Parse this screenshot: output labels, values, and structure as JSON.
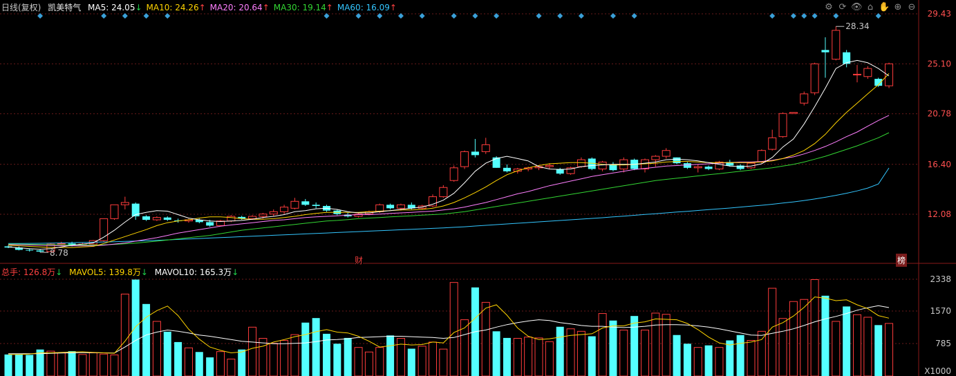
{
  "header": {
    "period": "日线(复权)",
    "stock_name": "凯美特气",
    "ma": [
      {
        "label": "MA5: 24.05",
        "arrow": "↓",
        "color": "#ffffff",
        "arrow_color": "#1fd04a"
      },
      {
        "label": "MA10: 24.26",
        "arrow": "↑",
        "color": "#ffd400",
        "arrow_color": "#ff4040"
      },
      {
        "label": "MA20: 20.64",
        "arrow": "↑",
        "color": "#ff7fff",
        "arrow_color": "#ff4040"
      },
      {
        "label": "MA30: 19.14",
        "arrow": "↑",
        "color": "#33d633",
        "arrow_color": "#ff4040"
      },
      {
        "label": "MA60: 16.09",
        "arrow": "↑",
        "color": "#33c6ff",
        "arrow_color": "#ff4040"
      }
    ]
  },
  "vol_header": {
    "total": {
      "label": "总手: 126.8万",
      "arrow": "↓",
      "color": "#ff4040",
      "arrow_color": "#1fd04a"
    },
    "mavol5": {
      "label": "MAVOL5: 139.8万",
      "arrow": "↓",
      "color": "#ffd400",
      "arrow_color": "#1fd04a"
    },
    "mavol10": {
      "label": "MAVOL10: 165.3万",
      "arrow": "↓",
      "color": "#ffffff",
      "arrow_color": "#1fd04a"
    }
  },
  "toolbar": {
    "icons": [
      "gear-icon",
      "refresh-icon",
      "eye-icon",
      "shop-icon",
      "hand-icon",
      "zoom-in-icon",
      "zoom-out-icon"
    ],
    "glyphs": [
      "⚙",
      "⟳",
      "👁",
      "⌂",
      "✋",
      "⊕",
      "⊖"
    ]
  },
  "markers": {
    "cai": "财",
    "bang": "榜"
  },
  "annotations": {
    "high": "28.34",
    "low": "8.78"
  },
  "colors": {
    "up": "#ff3c3c",
    "down": "#54ffff",
    "grid": "#6a1a1a",
    "ma5": "#ffffff",
    "ma10": "#ffd400",
    "ma20": "#ff7fff",
    "ma30": "#33d633",
    "ma60": "#33c6ff",
    "diamond": "#3aa0d8"
  },
  "chart_data": [
    {
      "type": "candlestick",
      "title": "",
      "y_ticks": [
        "29.43",
        "25.10",
        "20.78",
        "16.40",
        "12.08"
      ],
      "ylim": [
        8.0,
        30.5
      ],
      "candles": [
        [
          9.3,
          9.4,
          9.15,
          9.2
        ],
        [
          9.2,
          9.3,
          8.95,
          9.0
        ],
        [
          9.0,
          9.1,
          8.85,
          8.95
        ],
        [
          8.95,
          9.05,
          8.78,
          8.85
        ],
        [
          8.85,
          9.6,
          8.8,
          9.5
        ],
        [
          9.5,
          9.7,
          9.4,
          9.55
        ],
        [
          9.55,
          9.7,
          9.3,
          9.4
        ],
        [
          9.4,
          9.6,
          9.35,
          9.5
        ],
        [
          9.5,
          9.85,
          9.45,
          9.8
        ],
        [
          9.8,
          11.7,
          9.7,
          11.7
        ],
        [
          11.7,
          12.9,
          11.6,
          12.9
        ],
        [
          12.9,
          13.6,
          12.5,
          13.1
        ],
        [
          13.0,
          13.1,
          11.6,
          11.9
        ],
        [
          11.9,
          12.0,
          11.5,
          11.6
        ],
        [
          11.6,
          11.9,
          11.5,
          11.8
        ],
        [
          11.8,
          11.9,
          11.5,
          11.6
        ],
        [
          11.55,
          11.7,
          11.35,
          11.5
        ],
        [
          11.5,
          11.7,
          11.35,
          11.6
        ],
        [
          11.6,
          11.7,
          11.3,
          11.4
        ],
        [
          11.4,
          11.6,
          11.0,
          11.1
        ],
        [
          11.1,
          11.6,
          11.05,
          11.5
        ],
        [
          11.5,
          12.0,
          11.4,
          11.9
        ],
        [
          11.85,
          11.95,
          11.6,
          11.7
        ],
        [
          11.7,
          12.0,
          11.6,
          11.9
        ],
        [
          11.9,
          12.2,
          11.7,
          12.1
        ],
        [
          12.1,
          12.5,
          11.9,
          12.3
        ],
        [
          12.3,
          12.9,
          12.1,
          12.7
        ],
        [
          12.6,
          13.5,
          12.5,
          13.2
        ],
        [
          13.2,
          13.4,
          12.8,
          12.9
        ],
        [
          12.9,
          13.1,
          12.6,
          12.8
        ],
        [
          12.8,
          12.9,
          12.3,
          12.4
        ],
        [
          12.4,
          12.5,
          12.0,
          12.1
        ],
        [
          12.05,
          12.2,
          11.8,
          11.9
        ],
        [
          11.9,
          12.2,
          11.8,
          12.1
        ],
        [
          12.1,
          12.4,
          12.0,
          12.3
        ],
        [
          12.3,
          13.0,
          12.2,
          12.9
        ],
        [
          12.9,
          13.0,
          12.5,
          12.6
        ],
        [
          12.6,
          13.0,
          12.4,
          12.9
        ],
        [
          12.9,
          13.1,
          12.5,
          12.6
        ],
        [
          12.6,
          12.9,
          12.5,
          12.8
        ],
        [
          12.8,
          13.8,
          12.7,
          13.6
        ],
        [
          13.6,
          14.6,
          13.5,
          14.4
        ],
        [
          15.0,
          16.3,
          14.9,
          16.1
        ],
        [
          16.2,
          17.6,
          16.0,
          17.5
        ],
        [
          17.5,
          18.6,
          17.0,
          17.2
        ],
        [
          17.5,
          18.7,
          17.3,
          18.1
        ],
        [
          17.0,
          17.1,
          16.1,
          16.1
        ],
        [
          16.1,
          16.4,
          15.7,
          15.8
        ],
        [
          15.8,
          16.1,
          15.6,
          16.0
        ],
        [
          16.0,
          16.2,
          15.8,
          16.1
        ],
        [
          16.1,
          16.3,
          15.9,
          16.2
        ],
        [
          16.2,
          16.5,
          16.0,
          16.3
        ],
        [
          16.0,
          16.1,
          15.5,
          15.6
        ],
        [
          15.6,
          16.2,
          15.5,
          16.1
        ],
        [
          16.2,
          17.0,
          16.1,
          16.8
        ],
        [
          16.9,
          17.0,
          15.9,
          16.0
        ],
        [
          16.0,
          16.7,
          15.8,
          16.6
        ],
        [
          16.4,
          16.6,
          15.8,
          15.9
        ],
        [
          16.0,
          17.0,
          15.7,
          16.8
        ],
        [
          16.8,
          16.9,
          15.9,
          16.0
        ],
        [
          16.0,
          16.9,
          15.7,
          16.8
        ],
        [
          16.8,
          17.2,
          16.2,
          17.1
        ],
        [
          17.1,
          17.8,
          16.9,
          17.6
        ],
        [
          17.0,
          17.0,
          16.4,
          16.5
        ],
        [
          16.5,
          16.6,
          16.0,
          16.1
        ],
        [
          16.1,
          16.4,
          15.7,
          16.2
        ],
        [
          16.2,
          16.3,
          15.9,
          16.0
        ],
        [
          16.0,
          16.7,
          15.9,
          16.6
        ],
        [
          16.6,
          16.8,
          16.2,
          16.3
        ],
        [
          16.3,
          16.4,
          15.9,
          16.0
        ],
        [
          16.1,
          16.6,
          16.0,
          16.5
        ],
        [
          16.6,
          17.7,
          16.5,
          17.6
        ],
        [
          17.7,
          19.4,
          17.6,
          18.7
        ],
        [
          18.8,
          20.9,
          18.7,
          20.8
        ],
        [
          20.8,
          20.9,
          20.8,
          20.9
        ],
        [
          21.7,
          22.7,
          21.5,
          22.5
        ],
        [
          22.6,
          25.2,
          22.4,
          25.1
        ],
        [
          26.3,
          27.4,
          23.9,
          26.1
        ],
        [
          25.5,
          28.34,
          25.4,
          28.0
        ],
        [
          26.1,
          26.3,
          24.8,
          25.1
        ],
        [
          24.2,
          25.0,
          23.5,
          24.2
        ],
        [
          24.0,
          24.9,
          23.8,
          24.7
        ],
        [
          23.8,
          23.9,
          23.1,
          23.2
        ],
        [
          23.2,
          25.2,
          23.0,
          25.1
        ]
      ],
      "ma5": [
        9.25,
        9.18,
        9.1,
        9.05,
        9.1,
        9.25,
        9.4,
        9.5,
        9.6,
        10.1,
        10.7,
        11.4,
        12.05,
        12.25,
        12.4,
        12.35,
        12.05,
        11.75,
        11.6,
        11.5,
        11.45,
        11.5,
        11.55,
        11.65,
        11.8,
        11.9,
        12.05,
        12.3,
        12.4,
        12.55,
        12.6,
        12.5,
        12.3,
        12.2,
        12.2,
        12.3,
        12.4,
        12.5,
        12.6,
        12.7,
        12.95,
        13.3,
        13.9,
        14.8,
        15.8,
        16.5,
        16.9,
        17.1,
        16.9,
        16.7,
        16.2,
        16.0,
        15.95,
        16.0,
        16.2,
        16.3,
        16.35,
        16.4,
        16.4,
        16.4,
        16.5,
        16.6,
        16.8,
        16.85,
        16.8,
        16.7,
        16.55,
        16.4,
        16.25,
        16.2,
        16.25,
        16.45,
        17.0,
        17.9,
        18.6,
        19.9,
        21.4,
        23.0,
        24.7,
        25.2,
        25.4,
        25.2,
        24.7,
        24.05
      ],
      "ma10": [
        9.4,
        9.35,
        9.3,
        9.25,
        9.2,
        9.2,
        9.2,
        9.25,
        9.3,
        9.55,
        9.85,
        10.15,
        10.45,
        10.75,
        11.1,
        11.35,
        11.5,
        11.6,
        11.75,
        11.85,
        11.85,
        11.8,
        11.7,
        11.65,
        11.65,
        11.7,
        11.8,
        11.9,
        12.05,
        12.15,
        12.25,
        12.25,
        12.25,
        12.25,
        12.3,
        12.35,
        12.4,
        12.45,
        12.45,
        12.5,
        12.6,
        12.8,
        13.1,
        13.5,
        13.95,
        14.45,
        15.0,
        15.5,
        15.85,
        16.1,
        16.3,
        16.45,
        16.5,
        16.55,
        16.55,
        16.5,
        16.4,
        16.35,
        16.35,
        16.4,
        16.45,
        16.5,
        16.6,
        16.65,
        16.65,
        16.6,
        16.55,
        16.55,
        16.55,
        16.55,
        16.55,
        16.6,
        16.7,
        16.9,
        17.2,
        17.6,
        18.2,
        19.0,
        20.0,
        20.9,
        21.7,
        22.5,
        23.3,
        24.26
      ],
      "ma20": [
        9.45,
        9.45,
        9.42,
        9.4,
        9.38,
        9.36,
        9.35,
        9.35,
        9.35,
        9.4,
        9.5,
        9.6,
        9.75,
        9.9,
        10.05,
        10.25,
        10.45,
        10.6,
        10.75,
        10.9,
        11.05,
        11.15,
        11.25,
        11.35,
        11.45,
        11.55,
        11.6,
        11.7,
        11.8,
        11.85,
        11.9,
        11.95,
        12.0,
        12.05,
        12.05,
        12.1,
        12.15,
        12.2,
        12.25,
        12.3,
        12.35,
        12.45,
        12.55,
        12.7,
        12.9,
        13.1,
        13.35,
        13.6,
        13.85,
        14.05,
        14.3,
        14.55,
        14.75,
        14.95,
        15.15,
        15.35,
        15.5,
        15.65,
        15.8,
        15.95,
        16.05,
        16.15,
        16.25,
        16.3,
        16.35,
        16.4,
        16.45,
        16.5,
        16.55,
        16.6,
        16.6,
        16.65,
        16.75,
        16.9,
        17.05,
        17.3,
        17.6,
        17.95,
        18.35,
        18.8,
        19.2,
        19.7,
        20.2,
        20.64
      ],
      "ma30": [
        9.5,
        9.5,
        9.48,
        9.46,
        9.45,
        9.44,
        9.43,
        9.42,
        9.42,
        9.44,
        9.47,
        9.52,
        9.58,
        9.66,
        9.75,
        9.85,
        9.95,
        10.05,
        10.15,
        10.25,
        10.4,
        10.55,
        10.7,
        10.8,
        10.9,
        11.0,
        11.1,
        11.2,
        11.3,
        11.4,
        11.5,
        11.55,
        11.62,
        11.7,
        11.75,
        11.8,
        11.85,
        11.9,
        11.95,
        12.0,
        12.05,
        12.1,
        12.2,
        12.3,
        12.45,
        12.6,
        12.75,
        12.9,
        13.05,
        13.2,
        13.35,
        13.5,
        13.65,
        13.8,
        13.95,
        14.1,
        14.25,
        14.4,
        14.55,
        14.7,
        14.85,
        15.0,
        15.1,
        15.2,
        15.3,
        15.4,
        15.5,
        15.6,
        15.7,
        15.8,
        15.9,
        16.0,
        16.1,
        16.25,
        16.4,
        16.6,
        16.85,
        17.1,
        17.4,
        17.7,
        18.0,
        18.35,
        18.7,
        19.14
      ],
      "ma60": [
        9.55,
        9.55,
        9.56,
        9.57,
        9.58,
        9.6,
        9.62,
        9.64,
        9.66,
        9.68,
        9.7,
        9.73,
        9.76,
        9.79,
        9.82,
        9.86,
        9.9,
        9.94,
        9.98,
        10.02,
        10.06,
        10.1,
        10.14,
        10.18,
        10.22,
        10.26,
        10.3,
        10.34,
        10.38,
        10.42,
        10.46,
        10.5,
        10.54,
        10.58,
        10.62,
        10.66,
        10.7,
        10.74,
        10.78,
        10.82,
        10.86,
        10.9,
        10.95,
        11.0,
        11.06,
        11.12,
        11.18,
        11.24,
        11.3,
        11.36,
        11.42,
        11.48,
        11.54,
        11.6,
        11.66,
        11.72,
        11.78,
        11.85,
        11.92,
        11.99,
        12.06,
        12.13,
        12.2,
        12.27,
        12.34,
        12.41,
        12.48,
        12.55,
        12.62,
        12.7,
        12.78,
        12.86,
        12.95,
        13.05,
        13.15,
        13.27,
        13.4,
        13.55,
        13.72,
        13.9,
        14.1,
        14.35,
        14.7,
        16.09
      ]
    },
    {
      "type": "bar",
      "title": "",
      "y_ticks": [
        "2338",
        "1570",
        "785"
      ],
      "y_unit": "X1000",
      "ylim": [
        0,
        2400
      ],
      "volumes": [
        520,
        520,
        510,
        640,
        600,
        560,
        600,
        520,
        560,
        530,
        510,
        1980,
        2330,
        1740,
        1320,
        1070,
        820,
        680,
        580,
        450,
        590,
        410,
        640,
        1180,
        910,
        790,
        860,
        1000,
        1290,
        1400,
        1020,
        780,
        920,
        690,
        580,
        690,
        980,
        910,
        660,
        720,
        820,
        650,
        2260,
        1360,
        2140,
        1780,
        1080,
        920,
        910,
        940,
        920,
        830,
        1190,
        1140,
        1080,
        960,
        1510,
        1340,
        1110,
        1450,
        1110,
        1520,
        1490,
        990,
        780,
        690,
        740,
        690,
        860,
        990,
        860,
        1080,
        2120,
        1390,
        1800,
        1850,
        2330,
        1940,
        1320,
        1680,
        1480,
        1420,
        1230,
        1270
      ],
      "mavol5": [
        520,
        520,
        530,
        560,
        560,
        570,
        580,
        585,
        570,
        560,
        550,
        840,
        1190,
        1420,
        1580,
        1690,
        1460,
        1130,
        890,
        700,
        620,
        560,
        580,
        670,
        720,
        820,
        880,
        950,
        1000,
        1070,
        1120,
        1060,
        1040,
        960,
        840,
        700,
        730,
        770,
        750,
        760,
        820,
        800,
        1050,
        1160,
        1400,
        1640,
        1720,
        1470,
        1160,
        960,
        880,
        900,
        940,
        980,
        1000,
        1020,
        1160,
        1210,
        1210,
        1280,
        1310,
        1380,
        1370,
        1360,
        1270,
        1120,
        940,
        800,
        750,
        790,
        820,
        880,
        1180,
        1290,
        1450,
        1660,
        1910,
        1880,
        1820,
        1840,
        1720,
        1630,
        1460,
        1398
      ],
      "mavol10": [
        540,
        540,
        540,
        540,
        550,
        555,
        560,
        565,
        565,
        560,
        555,
        700,
        860,
        990,
        1060,
        1110,
        1080,
        1040,
        990,
        960,
        920,
        880,
        840,
        820,
        800,
        780,
        780,
        790,
        800,
        830,
        870,
        880,
        900,
        930,
        940,
        950,
        960,
        960,
        950,
        940,
        930,
        910,
        930,
        1000,
        1070,
        1110,
        1180,
        1240,
        1290,
        1330,
        1360,
        1340,
        1290,
        1260,
        1220,
        1200,
        1200,
        1180,
        1170,
        1180,
        1200,
        1230,
        1240,
        1240,
        1230,
        1210,
        1180,
        1140,
        1090,
        1040,
        990,
        980,
        1030,
        1080,
        1140,
        1220,
        1310,
        1380,
        1440,
        1510,
        1590,
        1650,
        1700,
        1653
      ]
    }
  ]
}
